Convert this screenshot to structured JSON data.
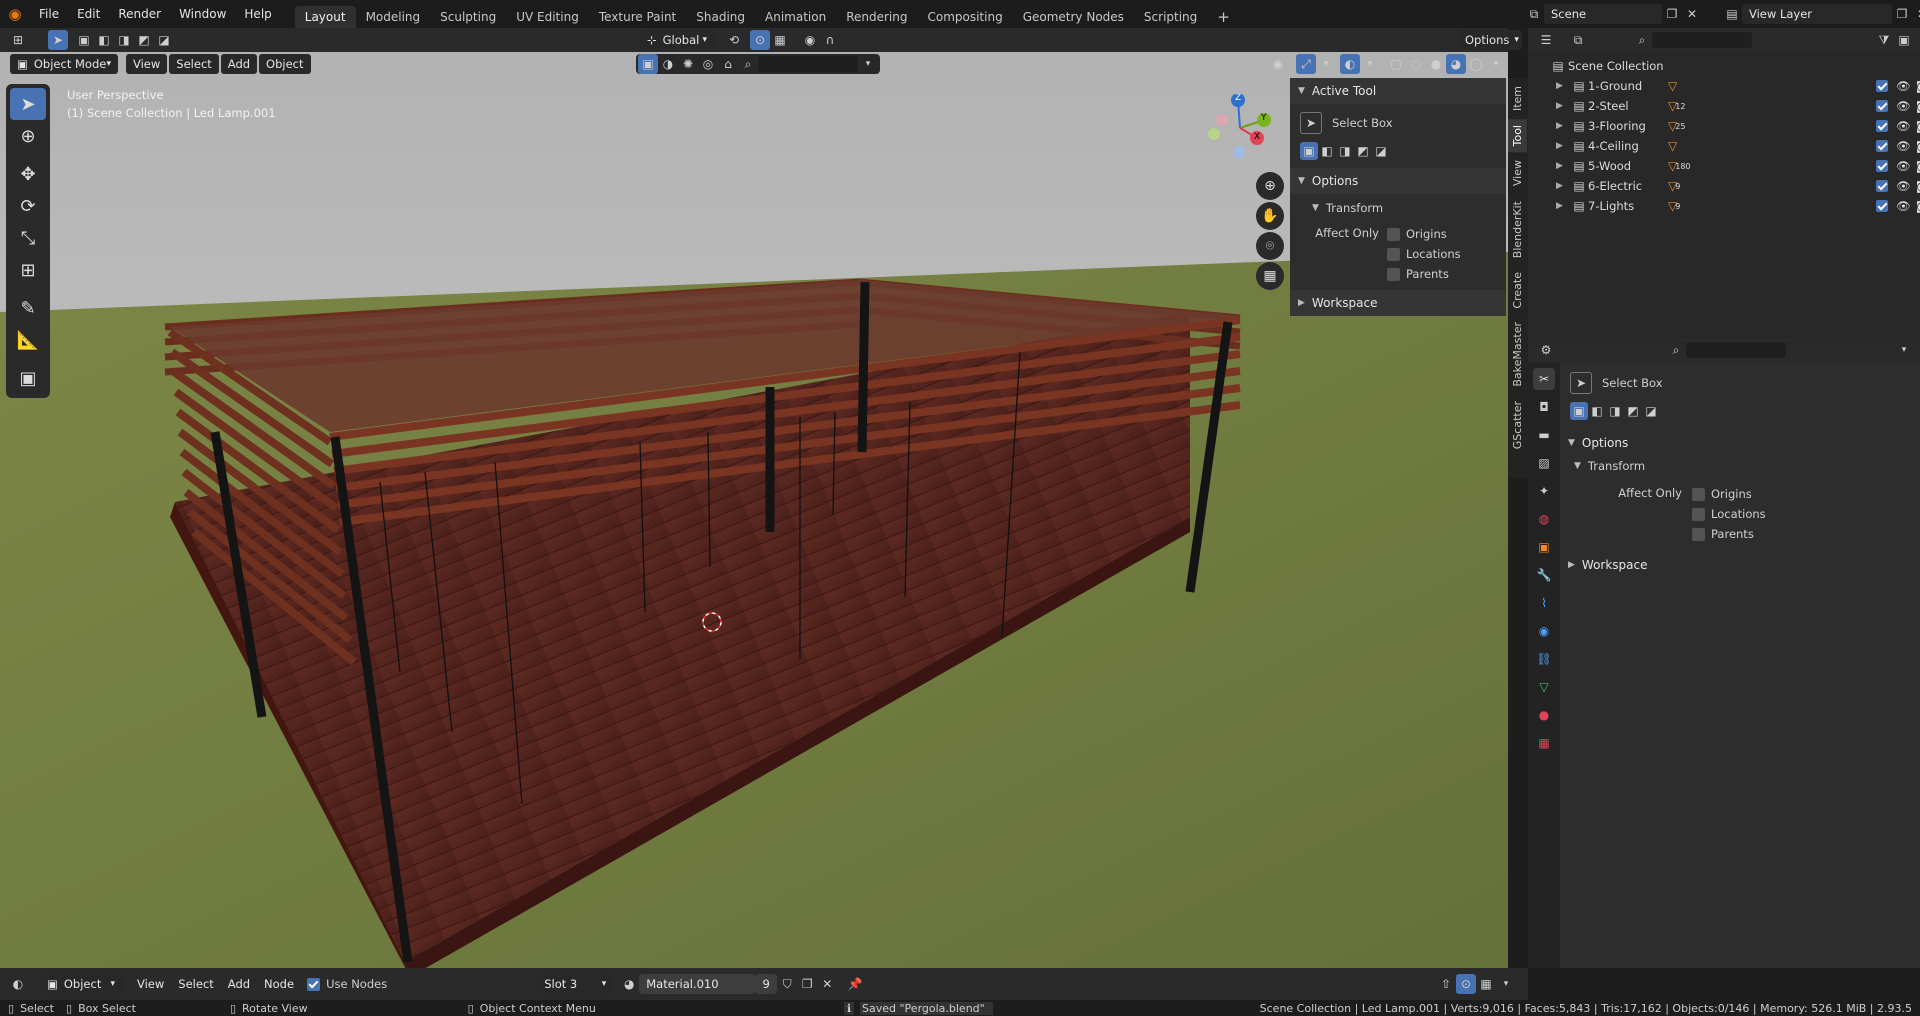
{
  "menu": {
    "items": [
      "File",
      "Edit",
      "Render",
      "Window",
      "Help"
    ]
  },
  "workspaces": [
    "Layout",
    "Modeling",
    "Sculpting",
    "UV Editing",
    "Texture Paint",
    "Shading",
    "Animation",
    "Rendering",
    "Compositing",
    "Geometry Nodes",
    "Scripting"
  ],
  "active_workspace": "Layout",
  "scene_name": "Scene",
  "view_layer": "View Layer",
  "viewport_header": {
    "transform_orientation": "Global",
    "options_label": "Options",
    "mode": "Object Mode",
    "menus": [
      "View",
      "Select",
      "Add",
      "Object"
    ]
  },
  "viewport": {
    "perspective_label": "User Perspective",
    "context_label": "(1) Scene Collection | Led Lamp.001",
    "gizmo_axes": {
      "x": "X",
      "y": "Y",
      "z": "Z"
    }
  },
  "npanel": {
    "active_tool_title": "Active Tool",
    "tool_name": "Select Box",
    "options_title": "Options",
    "transform_title": "Transform",
    "affect_only_label": "Affect Only",
    "checks": [
      "Origins",
      "Locations",
      "Parents"
    ],
    "workspace_title": "Workspace",
    "tabs": [
      "Item",
      "Tool",
      "View",
      "BlenderKit",
      "Create",
      "BakeMaster",
      "GScatter"
    ]
  },
  "outliner": {
    "root": "Scene Collection",
    "collections": [
      {
        "name": "1-Ground",
        "badge": ""
      },
      {
        "name": "2-Steel",
        "badge": "12"
      },
      {
        "name": "3-Flooring",
        "badge": "25"
      },
      {
        "name": "4-Ceiling",
        "badge": ""
      },
      {
        "name": "5-Wood",
        "badge": "180"
      },
      {
        "name": "6-Electric",
        "badge": "9"
      },
      {
        "name": "7-Lights",
        "badge": "9"
      }
    ]
  },
  "properties": {
    "tool_name": "Select Box",
    "options_title": "Options",
    "transform_title": "Transform",
    "affect_only_label": "Affect Only",
    "checks": [
      "Origins",
      "Locations",
      "Parents"
    ],
    "workspace_title": "Workspace"
  },
  "shader_header": {
    "editor": "Object",
    "menus": [
      "View",
      "Select",
      "Add",
      "Node"
    ],
    "use_nodes_label": "Use Nodes",
    "slot": "Slot 3",
    "material": "Material.010",
    "users": "9"
  },
  "status": {
    "select": "Select",
    "box_select": "Box Select",
    "rotate_view": "Rotate View",
    "context_menu": "Object Context Menu",
    "saved_message": "Saved \"Pergola.blend\"",
    "stats": "Scene Collection | Led Lamp.001 | Verts:9,016 | Faces:5,843 | Tris:17,162 | Objects:0/146 | Memory: 526.1 MiB | 2.93.5"
  },
  "colors": {
    "accent": "#4772b3",
    "wood": "#6b2a1c",
    "grass": "#6f7a3c",
    "sky": "#c9c9c9"
  }
}
